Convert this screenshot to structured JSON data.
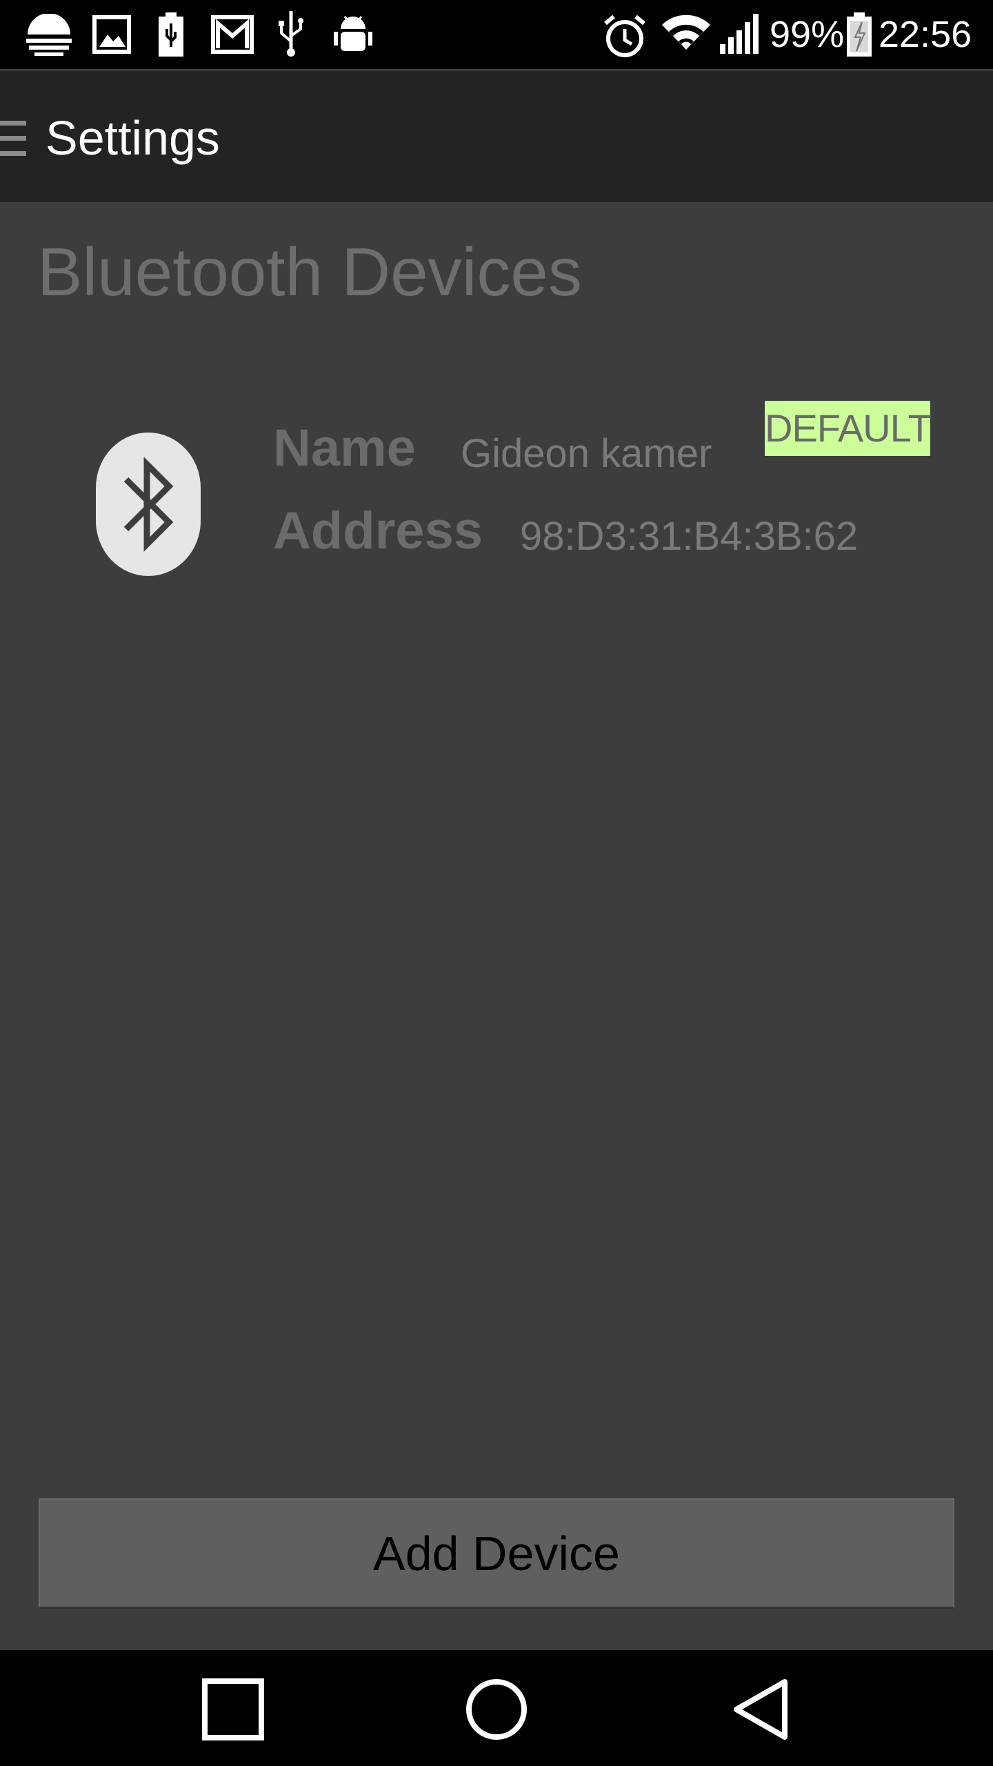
{
  "status_bar": {
    "battery_percent": "99%",
    "time": "22:56",
    "left_icons": [
      "weather-icon",
      "image-icon",
      "battery-usb-icon",
      "gmail-icon",
      "usb-icon",
      "android-debug-icon"
    ],
    "right_icons": [
      "alarm-icon",
      "wifi-icon",
      "signal-icon",
      "battery-charging-icon"
    ]
  },
  "action_bar": {
    "title": "Settings",
    "menu_icon": "drawer-menu-icon"
  },
  "content": {
    "section_title": "Bluetooth Devices",
    "devices": [
      {
        "icon": "bluetooth-icon",
        "name_label": "Name",
        "name_value": "Gideon kamer",
        "address_label": "Address",
        "address_value": "98:D3:31:B4:3B:62",
        "badge": "DEFAULT"
      }
    ],
    "add_button_label": "Add Device"
  },
  "nav_bar": {
    "buttons": [
      "recent-apps-icon",
      "home-icon",
      "back-icon"
    ]
  },
  "colors": {
    "content_bg": "#3d3d3d",
    "action_bar_bg": "#232323",
    "badge_bg": "#ccff99",
    "button_bg": "#5f5f5f"
  }
}
